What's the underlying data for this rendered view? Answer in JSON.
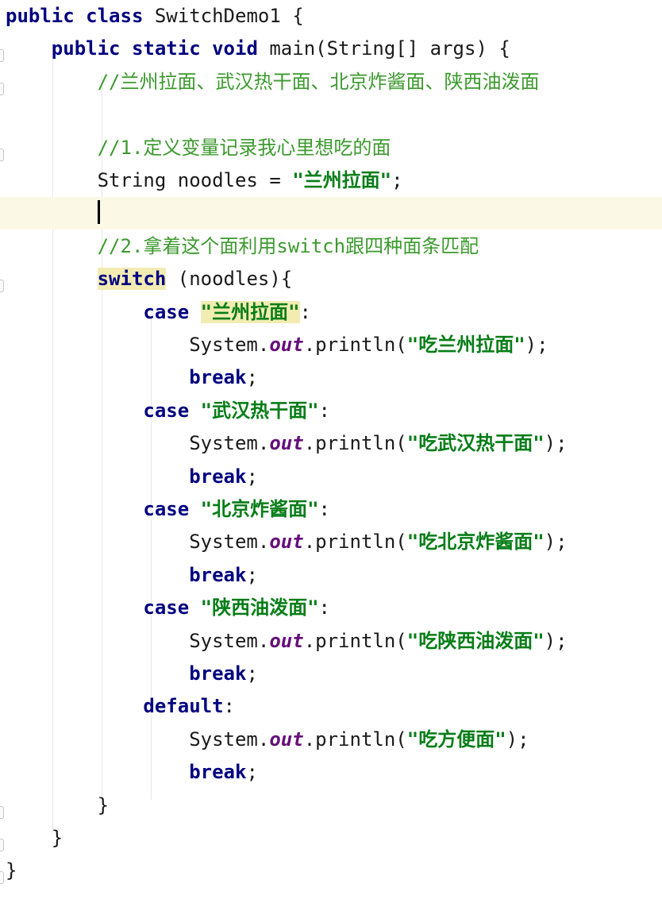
{
  "editor": {
    "lines": [
      {
        "indent": "",
        "tokens": [
          {
            "t": "public",
            "c": "kw"
          },
          {
            "t": " ",
            "c": "plain"
          },
          {
            "t": "class",
            "c": "kw"
          },
          {
            "t": " SwitchDemo1 {",
            "c": "plain"
          }
        ]
      },
      {
        "indent": "    ",
        "tokens": [
          {
            "t": "public",
            "c": "kw"
          },
          {
            "t": " ",
            "c": "plain"
          },
          {
            "t": "static",
            "c": "kw"
          },
          {
            "t": " ",
            "c": "plain"
          },
          {
            "t": "void",
            "c": "kw"
          },
          {
            "t": " main(String[] args) {",
            "c": "plain"
          }
        ]
      },
      {
        "indent": "        ",
        "tokens": [
          {
            "t": "//兰州拉面、武汉热干面、北京炸酱面、陕西油泼面",
            "c": "cm"
          }
        ]
      },
      {
        "indent": "",
        "tokens": []
      },
      {
        "indent": "        ",
        "tokens": [
          {
            "t": "//1.定义变量记录我心里想吃的面",
            "c": "cm"
          }
        ]
      },
      {
        "indent": "        ",
        "tokens": [
          {
            "t": "String noodles = ",
            "c": "plain"
          },
          {
            "t": "\"兰州拉面\"",
            "c": "str"
          },
          {
            "t": ";",
            "c": "plain"
          }
        ]
      },
      {
        "indent": "        ",
        "current": true,
        "caret": true,
        "tokens": []
      },
      {
        "indent": "        ",
        "tokens": [
          {
            "t": "//2.拿着这个面利用switch跟四种面条匹配",
            "c": "cm"
          }
        ]
      },
      {
        "indent": "        ",
        "tokens": [
          {
            "t": "switch",
            "c": "kwhl"
          },
          {
            "t": " (noodles){",
            "c": "plain"
          }
        ]
      },
      {
        "indent": "            ",
        "tokens": [
          {
            "t": "case",
            "c": "kw"
          },
          {
            "t": " ",
            "c": "plain"
          },
          {
            "t": "\"兰州拉面\"",
            "c": "str hl"
          },
          {
            "t": ":",
            "c": "plain"
          }
        ]
      },
      {
        "indent": "                ",
        "tokens": [
          {
            "t": "System.",
            "c": "plain"
          },
          {
            "t": "out",
            "c": "field"
          },
          {
            "t": ".println(",
            "c": "plain"
          },
          {
            "t": "\"吃兰州拉面\"",
            "c": "str"
          },
          {
            "t": ");",
            "c": "plain"
          }
        ]
      },
      {
        "indent": "                ",
        "tokens": [
          {
            "t": "break",
            "c": "kw"
          },
          {
            "t": ";",
            "c": "plain"
          }
        ]
      },
      {
        "indent": "            ",
        "tokens": [
          {
            "t": "case",
            "c": "kw"
          },
          {
            "t": " ",
            "c": "plain"
          },
          {
            "t": "\"武汉热干面\"",
            "c": "str"
          },
          {
            "t": ":",
            "c": "plain"
          }
        ]
      },
      {
        "indent": "                ",
        "tokens": [
          {
            "t": "System.",
            "c": "plain"
          },
          {
            "t": "out",
            "c": "field"
          },
          {
            "t": ".println(",
            "c": "plain"
          },
          {
            "t": "\"吃武汉热干面\"",
            "c": "str"
          },
          {
            "t": ");",
            "c": "plain"
          }
        ]
      },
      {
        "indent": "                ",
        "tokens": [
          {
            "t": "break",
            "c": "kw"
          },
          {
            "t": ";",
            "c": "plain"
          }
        ]
      },
      {
        "indent": "            ",
        "tokens": [
          {
            "t": "case",
            "c": "kw"
          },
          {
            "t": " ",
            "c": "plain"
          },
          {
            "t": "\"北京炸酱面\"",
            "c": "str"
          },
          {
            "t": ":",
            "c": "plain"
          }
        ]
      },
      {
        "indent": "                ",
        "tokens": [
          {
            "t": "System.",
            "c": "plain"
          },
          {
            "t": "out",
            "c": "field"
          },
          {
            "t": ".println(",
            "c": "plain"
          },
          {
            "t": "\"吃北京炸酱面\"",
            "c": "str"
          },
          {
            "t": ");",
            "c": "plain"
          }
        ]
      },
      {
        "indent": "                ",
        "tokens": [
          {
            "t": "break",
            "c": "kw"
          },
          {
            "t": ";",
            "c": "plain"
          }
        ]
      },
      {
        "indent": "            ",
        "tokens": [
          {
            "t": "case",
            "c": "kw"
          },
          {
            "t": " ",
            "c": "plain"
          },
          {
            "t": "\"陕西油泼面\"",
            "c": "str"
          },
          {
            "t": ":",
            "c": "plain"
          }
        ]
      },
      {
        "indent": "                ",
        "tokens": [
          {
            "t": "System.",
            "c": "plain"
          },
          {
            "t": "out",
            "c": "field"
          },
          {
            "t": ".println(",
            "c": "plain"
          },
          {
            "t": "\"吃陕西油泼面\"",
            "c": "str"
          },
          {
            "t": ");",
            "c": "plain"
          }
        ]
      },
      {
        "indent": "                ",
        "tokens": [
          {
            "t": "break",
            "c": "kw"
          },
          {
            "t": ";",
            "c": "plain"
          }
        ]
      },
      {
        "indent": "            ",
        "tokens": [
          {
            "t": "default",
            "c": "kw"
          },
          {
            "t": ":",
            "c": "plain"
          }
        ]
      },
      {
        "indent": "                ",
        "tokens": [
          {
            "t": "System.",
            "c": "plain"
          },
          {
            "t": "out",
            "c": "field"
          },
          {
            "t": ".println(",
            "c": "plain"
          },
          {
            "t": "\"吃方便面\"",
            "c": "str"
          },
          {
            "t": ");",
            "c": "plain"
          }
        ]
      },
      {
        "indent": "                ",
        "tokens": [
          {
            "t": "break",
            "c": "kw"
          },
          {
            "t": ";",
            "c": "plain"
          }
        ]
      },
      {
        "indent": "        ",
        "tokens": [
          {
            "t": "}",
            "c": "plain"
          }
        ]
      },
      {
        "indent": "    ",
        "tokens": [
          {
            "t": "}",
            "c": "plain"
          }
        ]
      },
      {
        "indent": "",
        "tokens": [
          {
            "t": "}",
            "c": "plain"
          }
        ]
      }
    ]
  },
  "colors": {
    "keyword": "#000080",
    "string": "#067d17",
    "comment": "#3c9a2e",
    "field": "#660e7a",
    "current_line": "#fbf8e6",
    "match_highlight": "#f2ecb3"
  }
}
